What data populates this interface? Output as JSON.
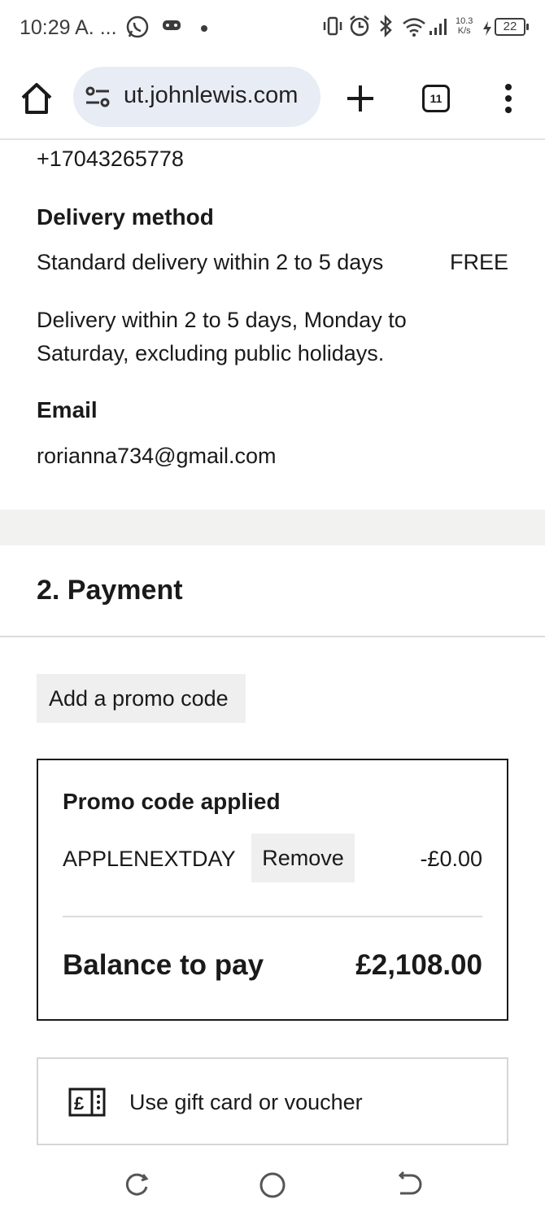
{
  "status_bar": {
    "time": "10:29 A. ...",
    "net_speed_value": "10.3",
    "net_speed_unit": "K/s",
    "battery": "22"
  },
  "browser": {
    "url": "ut.johnlewis.com",
    "tab_count": "11"
  },
  "contact": {
    "phone": "+17043265778"
  },
  "delivery": {
    "heading": "Delivery method",
    "method": "Standard delivery within 2 to 5 days",
    "price": "FREE",
    "note_line1": "Delivery within 2 to 5 days, Monday to",
    "note_line2": "Saturday, excluding public holidays."
  },
  "email": {
    "heading": "Email",
    "value": "rorianna734@gmail.com"
  },
  "payment": {
    "title": "2. Payment",
    "add_promo_label": "Add a promo code",
    "promo_box": {
      "title": "Promo code applied",
      "code": "APPLENEXTDAY",
      "remove_label": "Remove",
      "discount": "-£0.00",
      "balance_label": "Balance to pay",
      "balance_value": "£2,108.00"
    },
    "gift_card_label": "Use gift card or voucher"
  },
  "icons": {
    "home": "home-icon",
    "tune": "site-settings-icon",
    "new_tab": "plus-icon",
    "tabs": "tab-switcher-icon",
    "menu": "more-vert-icon",
    "gift": "gift-card-icon"
  }
}
